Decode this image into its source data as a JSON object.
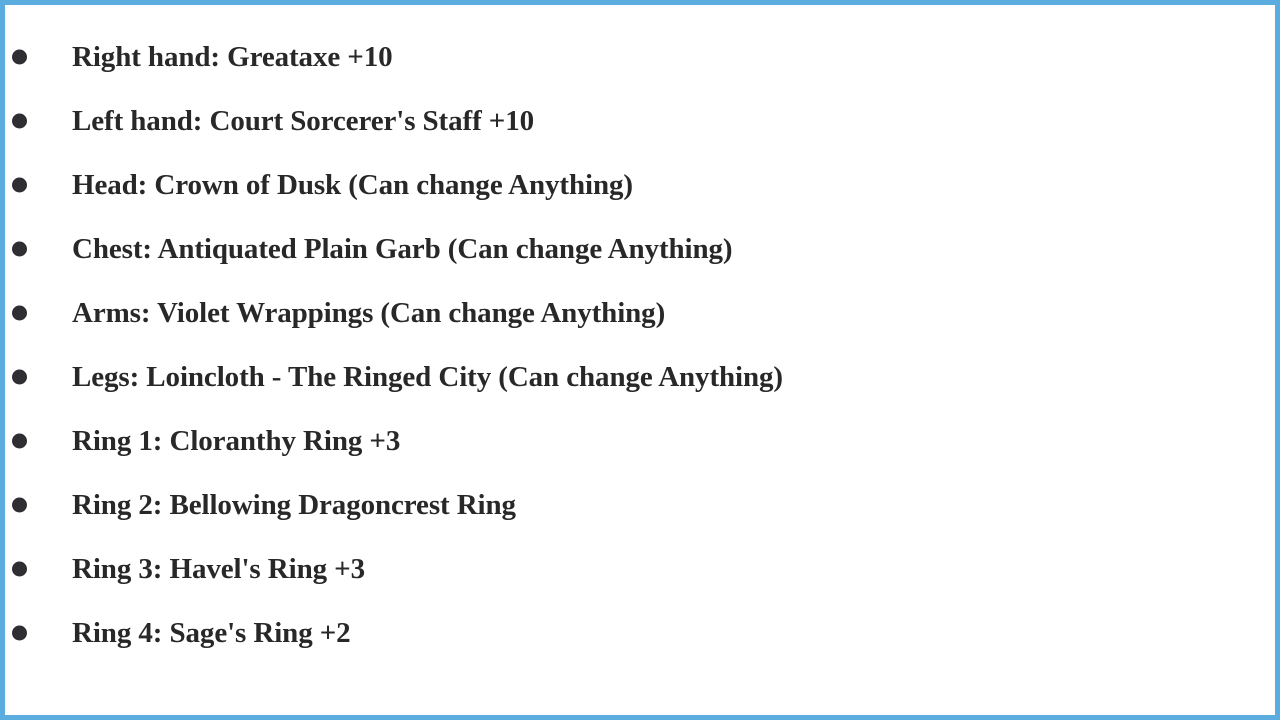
{
  "frame": {
    "border_color": "#5bade0",
    "background_color": "#ffffff"
  },
  "list": {
    "bullet_color": "#2f2f33",
    "text_color": "#282828",
    "items": [
      {
        "label": "Right hand: Greataxe +10"
      },
      {
        "label": "Left hand: Court Sorcerer's Staff +10"
      },
      {
        "label": "Head: Crown of Dusk (Can change Anything)"
      },
      {
        "label": "Chest: Antiquated Plain Garb (Can change Anything)"
      },
      {
        "label": "Arms: Violet Wrappings (Can change Anything)"
      },
      {
        "label": "Legs: Loincloth - The Ringed City (Can change Anything)"
      },
      {
        "label": "Ring 1: Cloranthy Ring +3"
      },
      {
        "label": "Ring 2: Bellowing Dragoncrest Ring"
      },
      {
        "label": "Ring 3: Havel's Ring +3"
      },
      {
        "label": "Ring 4: Sage's Ring +2"
      }
    ]
  }
}
